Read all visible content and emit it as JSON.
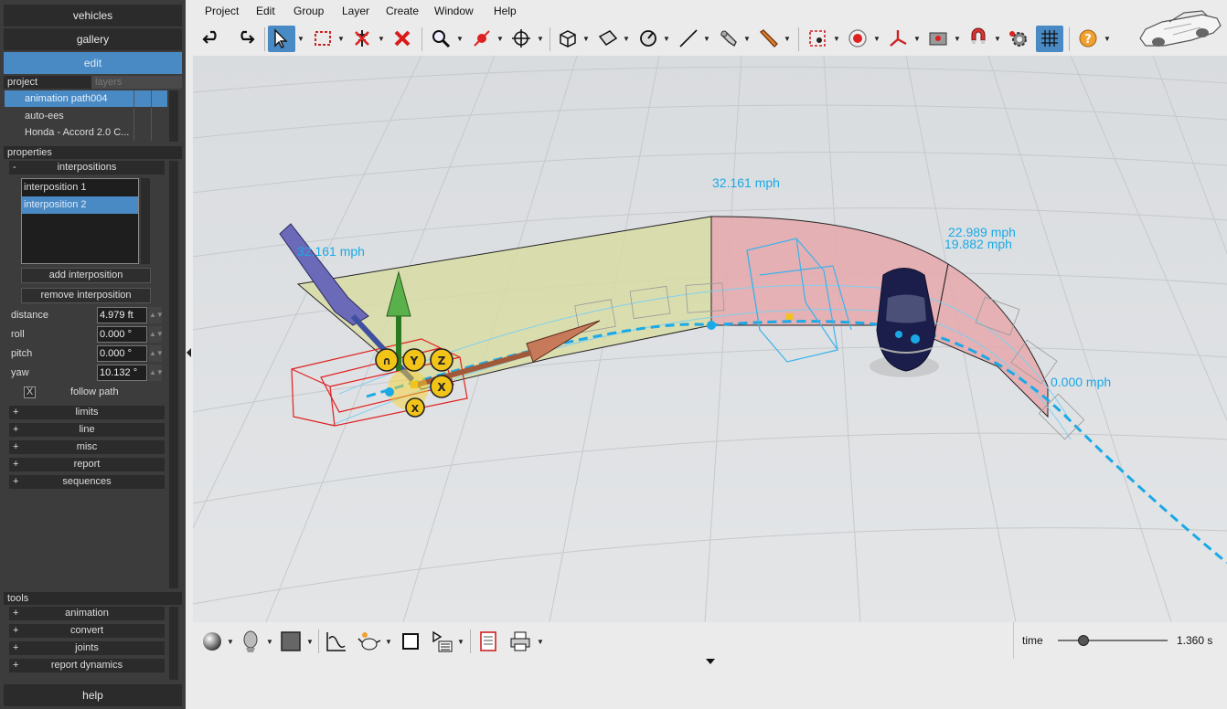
{
  "left_panel": {
    "top_buttons": {
      "vehicles": "vehicles",
      "gallery": "gallery",
      "edit": "edit"
    },
    "project_tab": "project",
    "layers_tab": "layers",
    "project_items": [
      "animation path004",
      "auto-ees",
      "Honda - Accord 2.0 C..."
    ],
    "properties_header": "properties",
    "interpositions_group": {
      "toggle": "-",
      "label": "interpositions"
    },
    "interposition_list": [
      "interposition 1",
      "interposition 2"
    ],
    "add_interposition": "add interposition",
    "remove_interposition": "remove interposition",
    "fields": [
      {
        "label": "distance",
        "value": "4.979 ft"
      },
      {
        "label": "roll",
        "value": "0.000 °"
      },
      {
        "label": "pitch",
        "value": "0.000 °"
      },
      {
        "label": "yaw",
        "value": "10.132 °"
      }
    ],
    "follow_path": {
      "checked_mark": "X",
      "label": "follow path"
    },
    "collapsed_groups": [
      "limits",
      "line",
      "misc",
      "report",
      "sequences"
    ],
    "tools_header": "tools",
    "tools_groups": [
      "animation",
      "convert",
      "joints",
      "report dynamics"
    ],
    "plus": "+",
    "help": "help"
  },
  "menu": [
    "Project",
    "Edit",
    "Group",
    "Layer",
    "Create",
    "Window",
    "Help"
  ],
  "toolbar_icons": [
    "undo-icon",
    "redo-icon",
    "select-arrow-icon",
    "box-select-icon",
    "delete-path-icon",
    "delete-icon",
    "zoom-icon",
    "pick-point-icon",
    "move-icon",
    "cube-view-icon",
    "surface-icon",
    "measure-angle-icon",
    "line-icon",
    "camera-icon",
    "light-icon",
    "target-icon",
    "record-icon",
    "axes-icon",
    "render-icon",
    "magnet-icon",
    "settings-icon",
    "grid-icon",
    "help-icon"
  ],
  "viewport": {
    "speed_labels": [
      "32.161 mph",
      "32.161 mph",
      "22.989 mph",
      "19.882 mph",
      "0.000 mph"
    ],
    "gizmo_labels": [
      "∩",
      "Y",
      "Z",
      "X",
      "X"
    ],
    "colors": {
      "path": "#1aa9e6",
      "yellow_zone": "#d8dca0",
      "red_zone": "#e6a8ac",
      "gizmo": "#f2c418"
    }
  },
  "bottom": {
    "time_label": "time",
    "time_value": "1.360 s",
    "time_fraction": 0.23
  }
}
